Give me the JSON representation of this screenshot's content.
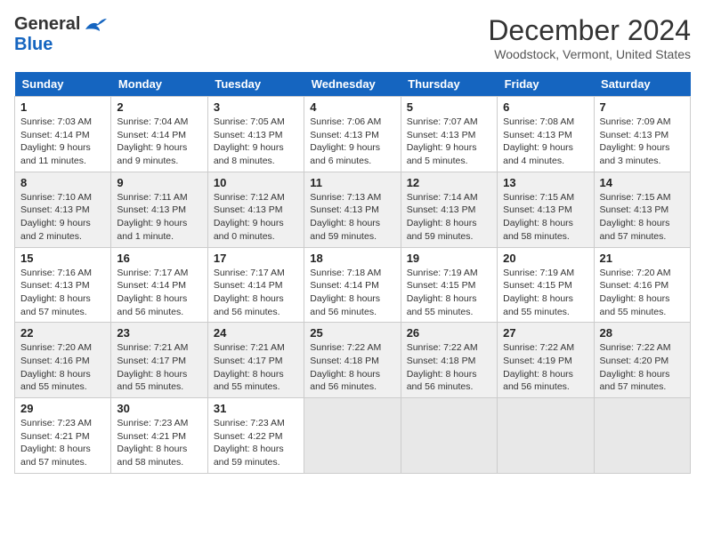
{
  "header": {
    "logo_line1": "General",
    "logo_line2": "Blue",
    "calendar_title": "December 2024",
    "calendar_subtitle": "Woodstock, Vermont, United States"
  },
  "days_of_week": [
    "Sunday",
    "Monday",
    "Tuesday",
    "Wednesday",
    "Thursday",
    "Friday",
    "Saturday"
  ],
  "weeks": [
    [
      {
        "day": "1",
        "sunrise": "7:03 AM",
        "sunset": "4:14 PM",
        "daylight": "9 hours and 11 minutes."
      },
      {
        "day": "2",
        "sunrise": "7:04 AM",
        "sunset": "4:14 PM",
        "daylight": "9 hours and 9 minutes."
      },
      {
        "day": "3",
        "sunrise": "7:05 AM",
        "sunset": "4:13 PM",
        "daylight": "9 hours and 8 minutes."
      },
      {
        "day": "4",
        "sunrise": "7:06 AM",
        "sunset": "4:13 PM",
        "daylight": "9 hours and 6 minutes."
      },
      {
        "day": "5",
        "sunrise": "7:07 AM",
        "sunset": "4:13 PM",
        "daylight": "9 hours and 5 minutes."
      },
      {
        "day": "6",
        "sunrise": "7:08 AM",
        "sunset": "4:13 PM",
        "daylight": "9 hours and 4 minutes."
      },
      {
        "day": "7",
        "sunrise": "7:09 AM",
        "sunset": "4:13 PM",
        "daylight": "9 hours and 3 minutes."
      }
    ],
    [
      {
        "day": "8",
        "sunrise": "7:10 AM",
        "sunset": "4:13 PM",
        "daylight": "9 hours and 2 minutes."
      },
      {
        "day": "9",
        "sunrise": "7:11 AM",
        "sunset": "4:13 PM",
        "daylight": "9 hours and 1 minute."
      },
      {
        "day": "10",
        "sunrise": "7:12 AM",
        "sunset": "4:13 PM",
        "daylight": "9 hours and 0 minutes."
      },
      {
        "day": "11",
        "sunrise": "7:13 AM",
        "sunset": "4:13 PM",
        "daylight": "8 hours and 59 minutes."
      },
      {
        "day": "12",
        "sunrise": "7:14 AM",
        "sunset": "4:13 PM",
        "daylight": "8 hours and 59 minutes."
      },
      {
        "day": "13",
        "sunrise": "7:15 AM",
        "sunset": "4:13 PM",
        "daylight": "8 hours and 58 minutes."
      },
      {
        "day": "14",
        "sunrise": "7:15 AM",
        "sunset": "4:13 PM",
        "daylight": "8 hours and 57 minutes."
      }
    ],
    [
      {
        "day": "15",
        "sunrise": "7:16 AM",
        "sunset": "4:13 PM",
        "daylight": "8 hours and 57 minutes."
      },
      {
        "day": "16",
        "sunrise": "7:17 AM",
        "sunset": "4:14 PM",
        "daylight": "8 hours and 56 minutes."
      },
      {
        "day": "17",
        "sunrise": "7:17 AM",
        "sunset": "4:14 PM",
        "daylight": "8 hours and 56 minutes."
      },
      {
        "day": "18",
        "sunrise": "7:18 AM",
        "sunset": "4:14 PM",
        "daylight": "8 hours and 56 minutes."
      },
      {
        "day": "19",
        "sunrise": "7:19 AM",
        "sunset": "4:15 PM",
        "daylight": "8 hours and 55 minutes."
      },
      {
        "day": "20",
        "sunrise": "7:19 AM",
        "sunset": "4:15 PM",
        "daylight": "8 hours and 55 minutes."
      },
      {
        "day": "21",
        "sunrise": "7:20 AM",
        "sunset": "4:16 PM",
        "daylight": "8 hours and 55 minutes."
      }
    ],
    [
      {
        "day": "22",
        "sunrise": "7:20 AM",
        "sunset": "4:16 PM",
        "daylight": "8 hours and 55 minutes."
      },
      {
        "day": "23",
        "sunrise": "7:21 AM",
        "sunset": "4:17 PM",
        "daylight": "8 hours and 55 minutes."
      },
      {
        "day": "24",
        "sunrise": "7:21 AM",
        "sunset": "4:17 PM",
        "daylight": "8 hours and 55 minutes."
      },
      {
        "day": "25",
        "sunrise": "7:22 AM",
        "sunset": "4:18 PM",
        "daylight": "8 hours and 56 minutes."
      },
      {
        "day": "26",
        "sunrise": "7:22 AM",
        "sunset": "4:18 PM",
        "daylight": "8 hours and 56 minutes."
      },
      {
        "day": "27",
        "sunrise": "7:22 AM",
        "sunset": "4:19 PM",
        "daylight": "8 hours and 56 minutes."
      },
      {
        "day": "28",
        "sunrise": "7:22 AM",
        "sunset": "4:20 PM",
        "daylight": "8 hours and 57 minutes."
      }
    ],
    [
      {
        "day": "29",
        "sunrise": "7:23 AM",
        "sunset": "4:21 PM",
        "daylight": "8 hours and 57 minutes."
      },
      {
        "day": "30",
        "sunrise": "7:23 AM",
        "sunset": "4:21 PM",
        "daylight": "8 hours and 58 minutes."
      },
      {
        "day": "31",
        "sunrise": "7:23 AM",
        "sunset": "4:22 PM",
        "daylight": "8 hours and 59 minutes."
      },
      null,
      null,
      null,
      null
    ]
  ]
}
